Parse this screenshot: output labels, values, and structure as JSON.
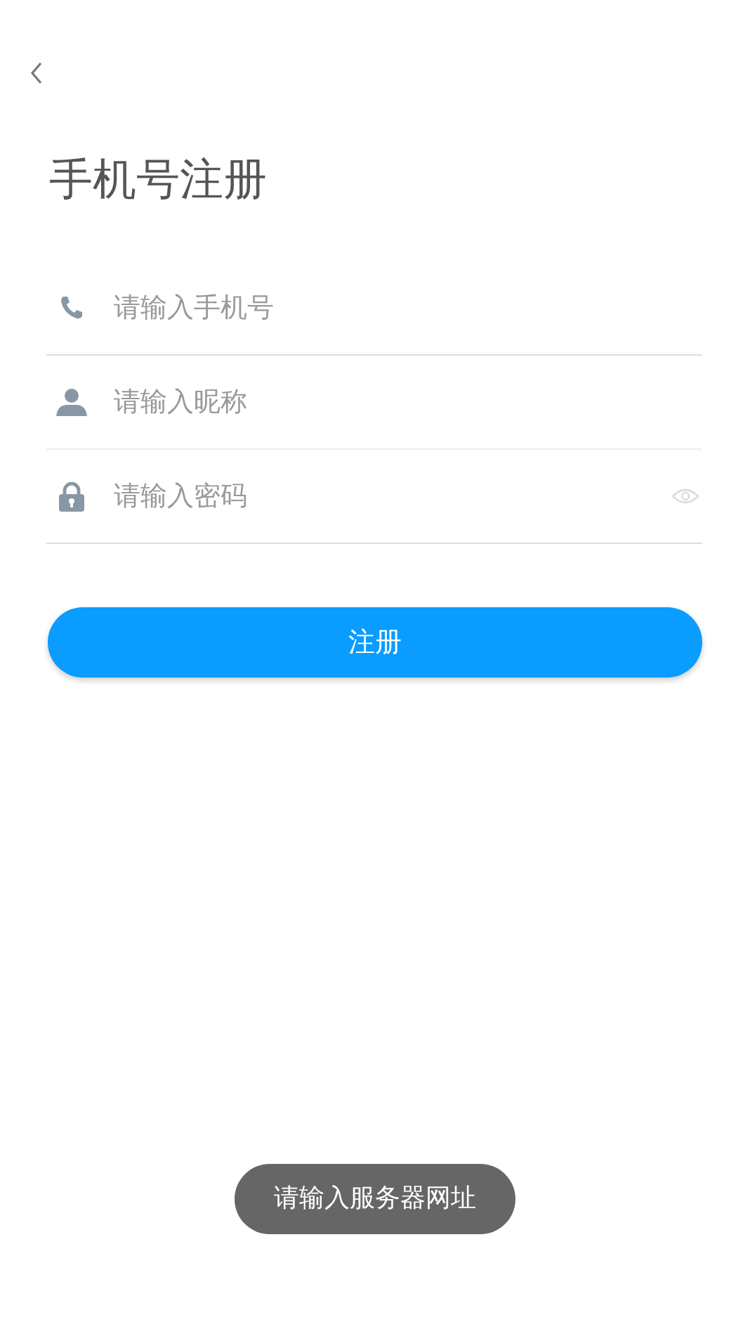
{
  "title": "手机号注册",
  "fields": [
    {
      "kind": "phone",
      "placeholder": "请输入手机号"
    },
    {
      "kind": "user",
      "placeholder": "请输入昵称"
    },
    {
      "kind": "password",
      "placeholder": "请输入密码"
    }
  ],
  "submit_button": "注册",
  "toast": "请输入服务器网址"
}
